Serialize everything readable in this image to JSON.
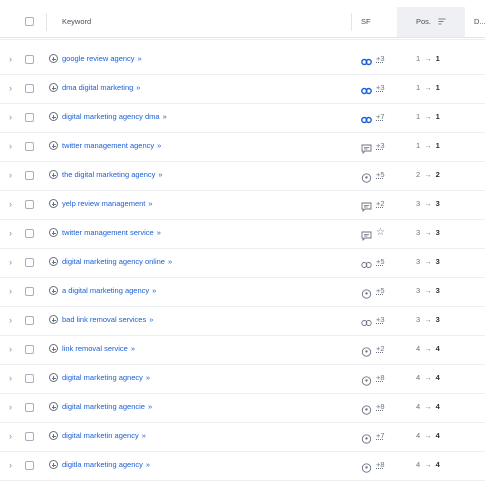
{
  "header": {
    "keyword": "Keyword",
    "sf": "SF",
    "pos": "Pos.",
    "d": "D..."
  },
  "arrow": "→",
  "chevron": "›",
  "double_chevron": "»",
  "rows": [
    {
      "keyword": "google review agency",
      "sf_icon": "link-icon",
      "sf_count": "+3",
      "pos_from": "1",
      "pos_to": "1"
    },
    {
      "keyword": "dma digital marketing",
      "sf_icon": "link-icon",
      "sf_count": "+3",
      "pos_from": "1",
      "pos_to": "1"
    },
    {
      "keyword": "digital marketing agency dma",
      "sf_icon": "link-icon",
      "sf_count": "+7",
      "pos_from": "1",
      "pos_to": "1"
    },
    {
      "keyword": "twitter management agency",
      "sf_icon": "comment-icon",
      "sf_count": "+3",
      "pos_from": "1",
      "pos_to": "1"
    },
    {
      "keyword": "the digital marketing agency",
      "sf_icon": "location-icon",
      "sf_count": "+5",
      "pos_from": "2",
      "pos_to": "2"
    },
    {
      "keyword": "yelp review management",
      "sf_icon": "comment-icon",
      "sf_count": "+2",
      "pos_from": "3",
      "pos_to": "3"
    },
    {
      "keyword": "twitter management service",
      "sf_icon": "comment-icon",
      "sf_count": "☆",
      "pos_from": "3",
      "pos_to": "3"
    },
    {
      "keyword": "digital marketing agency online",
      "sf_icon": "link-outline-icon",
      "sf_count": "+5",
      "pos_from": "3",
      "pos_to": "3"
    },
    {
      "keyword": "a digital marketing agency",
      "sf_icon": "location-icon",
      "sf_count": "+5",
      "pos_from": "3",
      "pos_to": "3"
    },
    {
      "keyword": "bad link removal services",
      "sf_icon": "link-outline-icon",
      "sf_count": "+3",
      "pos_from": "3",
      "pos_to": "3"
    },
    {
      "keyword": "link removal service",
      "sf_icon": "location-icon",
      "sf_count": "+2",
      "pos_from": "4",
      "pos_to": "4"
    },
    {
      "keyword": "digital marketing agnecy",
      "sf_icon": "location-icon",
      "sf_count": "+8",
      "pos_from": "4",
      "pos_to": "4"
    },
    {
      "keyword": "digital marketing agencie",
      "sf_icon": "location-icon",
      "sf_count": "+8",
      "pos_from": "4",
      "pos_to": "4"
    },
    {
      "keyword": "digital marketin agency",
      "sf_icon": "location-icon",
      "sf_count": "+7",
      "pos_from": "4",
      "pos_to": "4"
    },
    {
      "keyword": "digitla marketing agency",
      "sf_icon": "location-icon",
      "sf_count": "+8",
      "pos_from": "4",
      "pos_to": "4"
    }
  ]
}
